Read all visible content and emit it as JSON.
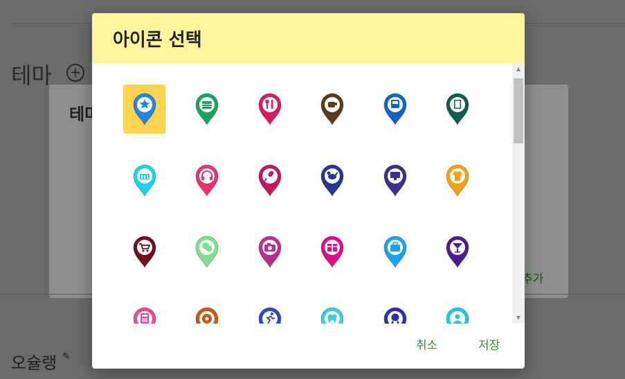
{
  "background": {
    "theme_title": "테마",
    "card_title": "테마",
    "card_add": "추가",
    "bottom_title": "오슐랭"
  },
  "dialog": {
    "title": "아이콘 선택",
    "cancel_label": "취소",
    "save_label": "저장",
    "selected_index": 0
  },
  "icons": [
    {
      "name": "star-pin-icon",
      "color": "#1e88e5",
      "glyph": "star"
    },
    {
      "name": "burger-pin-icon",
      "color": "#1aa260",
      "glyph": "burger"
    },
    {
      "name": "restaurant-pin-icon",
      "color": "#d81b60",
      "glyph": "fork"
    },
    {
      "name": "coffee-pin-icon",
      "color": "#5d3a1a",
      "glyph": "cup"
    },
    {
      "name": "bus-pin-icon",
      "color": "#1565c0",
      "glyph": "bus"
    },
    {
      "name": "book-pin-icon",
      "color": "#0f5e4e",
      "glyph": "book"
    },
    {
      "name": "basket-pin-icon",
      "color": "#18d6e8",
      "glyph": "basket"
    },
    {
      "name": "headphones-pin-icon",
      "color": "#e8336d",
      "glyph": "headphones"
    },
    {
      "name": "microphone-pin-icon",
      "color": "#c2185b",
      "glyph": "mic"
    },
    {
      "name": "pet-pin-icon",
      "color": "#283593",
      "glyph": "dog"
    },
    {
      "name": "monitor-pin-icon",
      "color": "#3f2f8a",
      "glyph": "monitor"
    },
    {
      "name": "shirt-pin-icon",
      "color": "#f2a314",
      "glyph": "shirt"
    },
    {
      "name": "cart-pin-icon",
      "color": "#6d1020",
      "glyph": "cart"
    },
    {
      "name": "chat-pin-icon",
      "color": "#7fe08e",
      "glyph": "chat"
    },
    {
      "name": "camera-pin-icon",
      "color": "#b8308e",
      "glyph": "camera"
    },
    {
      "name": "gift-pin-icon",
      "color": "#e00c86",
      "glyph": "gift"
    },
    {
      "name": "bag-pin-icon",
      "color": "#1aa3ec",
      "glyph": "bag"
    },
    {
      "name": "cocktail-pin-icon",
      "color": "#4a1f8c",
      "glyph": "cocktail"
    },
    {
      "name": "calculator-pin-icon",
      "color": "#ec4a8c",
      "glyph": "calc"
    },
    {
      "name": "donut-pin-icon",
      "color": "#c85a10",
      "glyph": "donut"
    },
    {
      "name": "runner-pin-icon",
      "color": "#3049c2",
      "glyph": "runner"
    },
    {
      "name": "tooth-pin-icon",
      "color": "#3ad0d8",
      "glyph": "tooth"
    },
    {
      "name": "award-pin-icon",
      "color": "#2f2fa8",
      "glyph": "award"
    },
    {
      "name": "user-pin-icon",
      "color": "#26c6da",
      "glyph": "user"
    }
  ]
}
